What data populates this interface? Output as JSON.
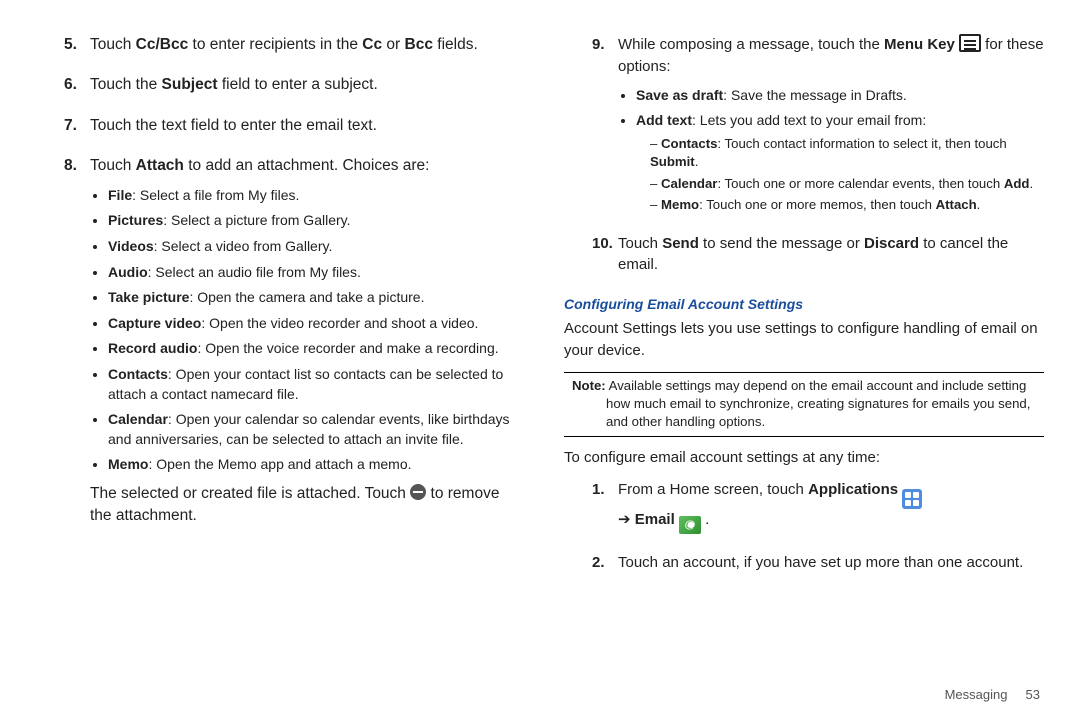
{
  "left": {
    "items": [
      {
        "n": "5.",
        "parts": [
          [
            "Touch ",
            false
          ],
          [
            "Cc/Bcc",
            true
          ],
          [
            " to enter recipients in the ",
            false
          ],
          [
            "Cc",
            true
          ],
          [
            " or ",
            false
          ],
          [
            "Bcc",
            true
          ],
          [
            " fields.",
            false
          ]
        ]
      },
      {
        "n": "6.",
        "parts": [
          [
            "Touch the ",
            false
          ],
          [
            "Subject",
            true
          ],
          [
            " field to enter a subject.",
            false
          ]
        ]
      },
      {
        "n": "7.",
        "parts": [
          [
            "Touch the text field to enter the email text.",
            false
          ]
        ]
      },
      {
        "n": "8.",
        "parts": [
          [
            "Touch ",
            false
          ],
          [
            "Attach",
            true
          ],
          [
            " to add an attachment. Choices are:",
            false
          ]
        ],
        "bullets": [
          [
            [
              "File",
              true
            ],
            [
              ": Select a file from My files.",
              false
            ]
          ],
          [
            [
              "Pictures",
              true
            ],
            [
              ": Select a picture from Gallery.",
              false
            ]
          ],
          [
            [
              "Videos",
              true
            ],
            [
              ": Select a video from Gallery.",
              false
            ]
          ],
          [
            [
              "Audio",
              true
            ],
            [
              ": Select an audio file from My files.",
              false
            ]
          ],
          [
            [
              "Take picture",
              true
            ],
            [
              ": Open the camera and take a picture.",
              false
            ]
          ],
          [
            [
              "Capture video",
              true
            ],
            [
              ": Open the video recorder and shoot a video.",
              false
            ]
          ],
          [
            [
              "Record audio",
              true
            ],
            [
              ": Open the voice recorder and make a recording.",
              false
            ]
          ],
          [
            [
              "Contacts",
              true
            ],
            [
              ": Open your contact list so contacts can be selected to attach a contact namecard file.",
              false
            ]
          ],
          [
            [
              "Calendar",
              true
            ],
            [
              ": Open your calendar so calendar events, like birthdays and anniversaries, can be selected to attach an invite file.",
              false
            ]
          ],
          [
            [
              "Memo",
              true
            ],
            [
              ": Open the Memo app and attach a memo.",
              false
            ]
          ]
        ],
        "tail_pre": "The selected or created file is attached. Touch ",
        "tail_post": " to remove the attachment."
      }
    ]
  },
  "right": {
    "item9": {
      "n": "9.",
      "line_pre": "While composing a message, touch the ",
      "menu_key": "Menu Key",
      "line_post": " for these options:",
      "bullets": [
        [
          [
            "Save as draft",
            true
          ],
          [
            ": Save the message in Drafts.",
            false
          ]
        ],
        [
          [
            "Add text",
            true
          ],
          [
            ": Lets you add text to your email from:",
            false
          ]
        ]
      ],
      "sub": [
        [
          [
            "Contacts",
            true
          ],
          [
            ": Touch contact information to select it, then touch ",
            false
          ],
          [
            "Submit",
            true
          ],
          [
            ".",
            false
          ]
        ],
        [
          [
            "Calendar",
            true
          ],
          [
            ": Touch one or more calendar events, then touch ",
            false
          ],
          [
            "Add",
            true
          ],
          [
            ".",
            false
          ]
        ],
        [
          [
            "Memo",
            true
          ],
          [
            ": Touch one or more memos, then touch ",
            false
          ],
          [
            "Attach",
            true
          ],
          [
            ".",
            false
          ]
        ]
      ]
    },
    "item10": {
      "n": "10.",
      "parts": [
        [
          "Touch ",
          false
        ],
        [
          "Send",
          true
        ],
        [
          " to send the message or ",
          false
        ],
        [
          "Discard",
          true
        ],
        [
          " to cancel the email.",
          false
        ]
      ]
    },
    "heading": "Configuring Email Account Settings",
    "intro": "Account Settings lets you use settings to configure handling of email on your device.",
    "note_bold": "Note:",
    "note_body": "Available settings may depend on the email account and include setting how much email to synchronize, creating signatures for emails you send, and other handling options.",
    "config_line": "To configure email account settings at any time:",
    "steps": {
      "s1": {
        "n": "1.",
        "pre": "From a Home screen, touch ",
        "apps": "Applications",
        "arrow": "➔",
        "email": "Email",
        "end": "."
      },
      "s2": {
        "n": "2.",
        "text": "Touch an account, if you have set up more than one account."
      }
    }
  },
  "footer": {
    "section": "Messaging",
    "page": "53"
  }
}
